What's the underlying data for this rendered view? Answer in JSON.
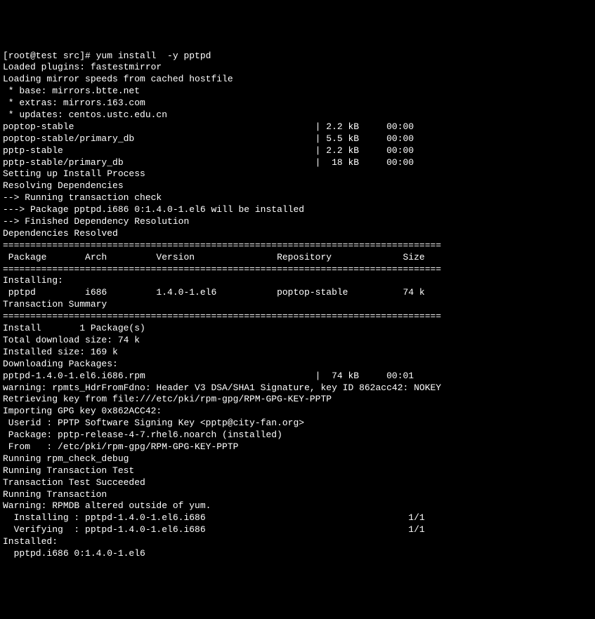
{
  "terminal": {
    "prompt": "[root@test src]# ",
    "command": "yum install  -y pptpd",
    "lines": [
      "Loaded plugins: fastestmirror",
      "Loading mirror speeds from cached hostfile",
      " * base: mirrors.btte.net",
      " * extras: mirrors.163.com",
      " * updates: centos.ustc.edu.cn",
      "poptop-stable                                            | 2.2 kB     00:00",
      "poptop-stable/primary_db                                 | 5.5 kB     00:00",
      "pptp-stable                                              | 2.2 kB     00:00",
      "pptp-stable/primary_db                                   |  18 kB     00:00",
      "Setting up Install Process",
      "Resolving Dependencies",
      "--> Running transaction check",
      "---> Package pptpd.i686 0:1.4.0-1.el6 will be installed",
      "--> Finished Dependency Resolution",
      "",
      "Dependencies Resolved",
      "",
      "================================================================================",
      " Package       Arch         Version               Repository             Size",
      "================================================================================",
      "Installing:",
      " pptpd         i686         1.4.0-1.el6           poptop-stable          74 k",
      "",
      "Transaction Summary",
      "================================================================================",
      "Install       1 Package(s)",
      "",
      "Total download size: 74 k",
      "Installed size: 169 k",
      "Downloading Packages:",
      "pptpd-1.4.0-1.el6.i686.rpm                               |  74 kB     00:01",
      "warning: rpmts_HdrFromFdno: Header V3 DSA/SHA1 Signature, key ID 862acc42: NOKEY",
      "Retrieving key from file:///etc/pki/rpm-gpg/RPM-GPG-KEY-PPTP",
      "Importing GPG key 0x862ACC42:",
      " Userid : PPTP Software Signing Key <pptp@city-fan.org>",
      " Package: pptp-release-4-7.rhel6.noarch (installed)",
      " From   : /etc/pki/rpm-gpg/RPM-GPG-KEY-PPTP",
      "Running rpm_check_debug",
      "Running Transaction Test",
      "Transaction Test Succeeded",
      "Running Transaction",
      "Warning: RPMDB altered outside of yum.",
      "  Installing : pptpd-1.4.0-1.el6.i686                                     1/1",
      "  Verifying  : pptpd-1.4.0-1.el6.i686                                     1/1",
      "",
      "Installed:",
      "  pptpd.i686 0:1.4.0-1.el6"
    ]
  }
}
